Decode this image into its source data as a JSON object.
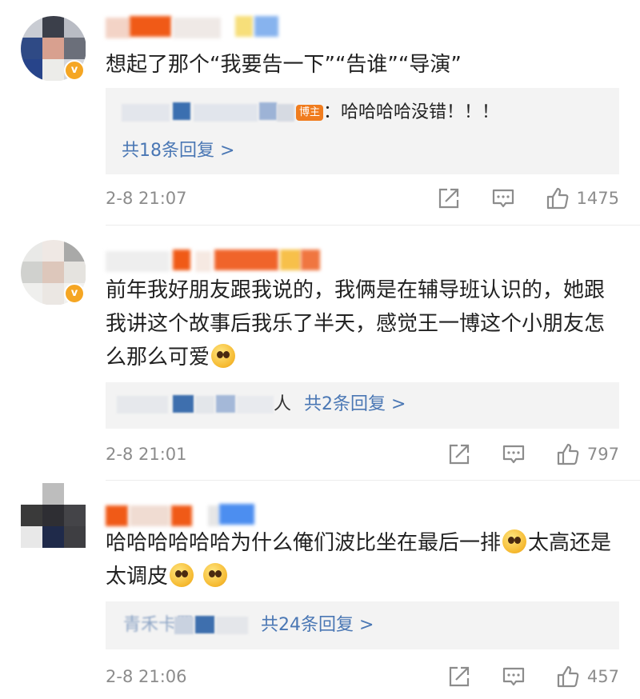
{
  "host_tag": "博主",
  "comments": [
    {
      "text": "想起了那个“我要告一下”“告谁”“导演”",
      "reply_text": "：哈哈哈哈没错！！！",
      "reply_count": "共18条回复 >",
      "time": "2-8 21:07",
      "likes": "1475"
    },
    {
      "text": "前年我好朋友跟我说的，我俩是在辅导班认识的，她跟我讲这个故事后我乐了半天，感觉王一博这个小朋友怎么那么可爱",
      "reply_prefix": "人",
      "reply_count": "共2条回复 >",
      "time": "2-8 21:01",
      "likes": "797"
    },
    {
      "text_a": "哈哈哈哈哈哈为什么俺们波比坐在最后一排",
      "text_b": "太高还是太调皮",
      "reply_prefix": "青禾卡罗",
      "reply_count": "共24条回复 >",
      "time": "2-8 21:06",
      "likes": "457"
    }
  ],
  "icons": [
    "share-icon",
    "comment-icon",
    "like-icon"
  ],
  "colors": {
    "link": "#4a77b4",
    "meta": "#8c8c8c",
    "badge": "#f5a623",
    "host_tag": "#f07c1e",
    "reply_bg": "#f3f3f3"
  }
}
